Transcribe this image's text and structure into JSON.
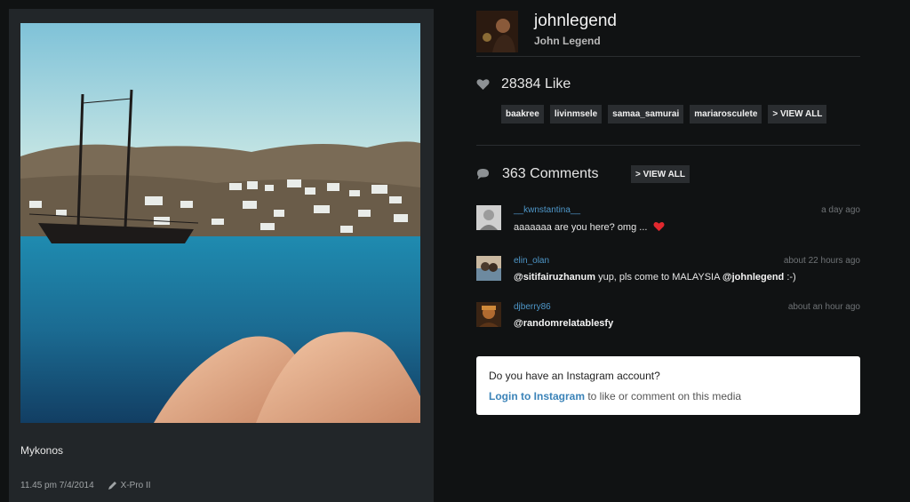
{
  "post": {
    "caption": "Mykonos",
    "date": "11.45 pm 7/4/2014",
    "filter": "X-Pro II"
  },
  "profile": {
    "username": "johnlegend",
    "full_name": "John Legend"
  },
  "likes": {
    "count_label": "28384 Like",
    "likers": [
      "baakree",
      "livinmsele",
      "samaa_samurai",
      "mariarosculete"
    ],
    "view_all": "> VIEW ALL"
  },
  "comments": {
    "count_label": "363 Comments",
    "view_all": "> VIEW ALL",
    "items": [
      {
        "user": "__kwnstantina__",
        "time": "a day ago",
        "text": "aaaaaaa are you here? omg ...",
        "text_mention": "",
        "text_tail": ""
      },
      {
        "user": "elin_olan",
        "time": "about 22 hours ago",
        "mention": "@sitifairuzhanum",
        "text": " yup, pls come to MALAYSIA ",
        "mention2": "@johnlegend",
        "text_tail": " :-)"
      },
      {
        "user": "djberry86",
        "time": "about an hour ago",
        "mention": "@randomrelatablesfy"
      }
    ]
  },
  "login_prompt": {
    "question": "Do you have an Instagram account?",
    "link": "Login to Instagram",
    "rest": " to like or comment on this media"
  },
  "icons": {
    "like": "heart-icon",
    "comment": "speech-bubble-icon",
    "filter": "pencil-icon",
    "emoji": "red-heart-emoji"
  },
  "colors": {
    "background": "#101213",
    "panel": "#222629",
    "link": "#4e97c9",
    "tag_bg": "#2a2d30"
  }
}
